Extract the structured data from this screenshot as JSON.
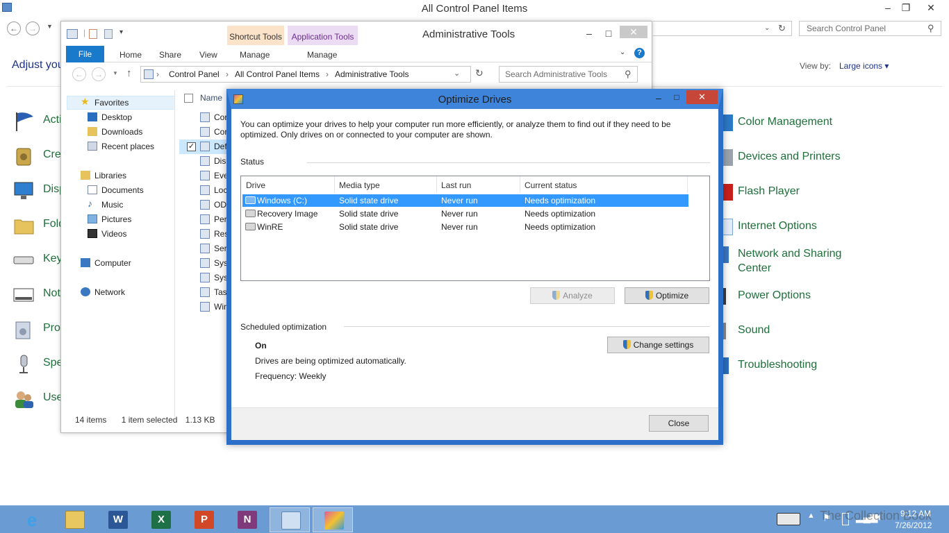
{
  "control_panel": {
    "title": "All Control Panel Items",
    "search_placeholder": "Search Control Panel",
    "heading": "Adjust you",
    "view_by_label": "View by:",
    "view_by_value": "Large icons ▾",
    "left_items": [
      "Acti",
      "Cre",
      "Disp",
      "Fold",
      "Key",
      "Not",
      "Pro",
      "Spe",
      "Use"
    ],
    "right_items": [
      "Color Management",
      "Devices and Printers",
      "Flash Player",
      "Internet Options",
      "Network and Sharing Center",
      "Power Options",
      "Sound",
      "Troubleshooting"
    ]
  },
  "admin_tools": {
    "title": "Administrative Tools",
    "context_tabs": {
      "shortcut": "Shortcut Tools",
      "application": "Application Tools"
    },
    "ribbon_tabs": {
      "file": "File",
      "home": "Home",
      "share": "Share",
      "view": "View",
      "manage1": "Manage",
      "manage2": "Manage"
    },
    "breadcrumb": [
      "Control Panel",
      "All Control Panel Items",
      "Administrative Tools"
    ],
    "search_placeholder": "Search Administrative Tools",
    "nav": {
      "favorites": "Favorites",
      "desktop": "Desktop",
      "downloads": "Downloads",
      "recent": "Recent places",
      "libraries": "Libraries",
      "documents": "Documents",
      "music": "Music",
      "pictures": "Pictures",
      "videos": "Videos",
      "computer": "Computer",
      "network": "Network"
    },
    "column_name": "Name",
    "files": [
      "Cor",
      "Cor",
      "Def",
      "Disk",
      "Eve",
      "Loc",
      "ODI",
      "Pert",
      "Res",
      "Serv",
      "Syst",
      "Syst",
      "Tas",
      "Win"
    ],
    "status": {
      "count": "14 items",
      "selected": "1 item selected",
      "size": "1.13 KB"
    }
  },
  "optimize_drives": {
    "title": "Optimize Drives",
    "description": "You can optimize your drives to help your computer run more efficiently, or analyze them to find out if they need to be optimized. Only drives on or connected to your computer are shown.",
    "status_label": "Status",
    "columns": {
      "drive": "Drive",
      "media": "Media type",
      "last": "Last run",
      "current": "Current status"
    },
    "drives": [
      {
        "drive": "Windows (C:)",
        "media": "Solid state drive",
        "last": "Never run",
        "status": "Needs optimization",
        "selected": true
      },
      {
        "drive": "Recovery Image",
        "media": "Solid state drive",
        "last": "Never run",
        "status": "Needs optimization",
        "selected": false
      },
      {
        "drive": "WinRE",
        "media": "Solid state drive",
        "last": "Never run",
        "status": "Needs optimization",
        "selected": false
      }
    ],
    "analyze_button": "Analyze",
    "optimize_button": "Optimize",
    "scheduled_label": "Scheduled optimization",
    "schedule_state": "On",
    "schedule_desc": "Drives are being optimized automatically.",
    "frequency": "Frequency: Weekly",
    "change_settings_button": "Change settings",
    "close_button": "Close"
  },
  "taskbar": {
    "time": "9:12 AM",
    "date": "7/26/2012",
    "watermark": "The Collection Book",
    "apps": [
      "Internet Explorer",
      "File Explorer",
      "Word",
      "Excel",
      "PowerPoint",
      "OneNote",
      "Control Panel",
      "Optimize Drives"
    ]
  },
  "colors": {
    "accent_blue": "#3d84da",
    "selection": "#3399ff",
    "link_green": "#1e6f3a",
    "taskbar": "#6a9bd3"
  }
}
